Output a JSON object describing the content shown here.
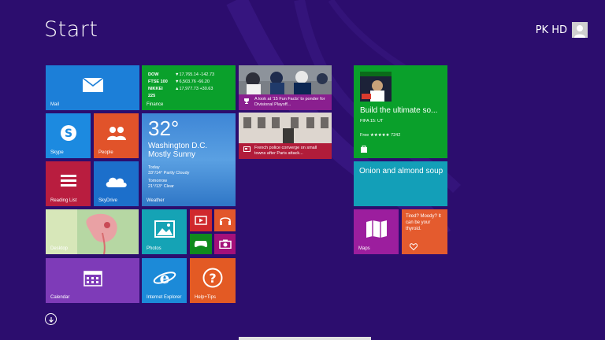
{
  "screen": {
    "title": "Start"
  },
  "user": {
    "name": "PK HD"
  },
  "tiles": {
    "mail": {
      "label": "Mail",
      "color": "#1c7fd8"
    },
    "finance": {
      "label": "Finance",
      "color": "#0aa02b",
      "rows": [
        {
          "name": "DOW",
          "value": "▼17,765.14 -142.73"
        },
        {
          "name": "FTSE 100",
          "value": "▼6,503.76 -66.20"
        },
        {
          "name": "NIKKEI 225",
          "value": "▲17,977.73 +30.63"
        }
      ]
    },
    "news1": {
      "caption": "A look at '15 Fun Facts' to ponder for Divisional Playoff..."
    },
    "news2": {
      "caption": "French police converge on small towns after Paris attack..."
    },
    "xbox": {
      "title": "Build the ultimate so...",
      "subtitle": "FIFA 15: UT",
      "price": "Free ★★★★★ 7242",
      "color": "#0aa02b"
    },
    "skype": {
      "label": "Skype",
      "color": "#1c8ae0"
    },
    "people": {
      "label": "People",
      "color": "#e1532a"
    },
    "weather": {
      "temp": "32°",
      "location": "Washington D.C.",
      "condition": "Mostly Sunny",
      "today_label": "Today",
      "today": "33°/14° Partly Cloudy",
      "tomorrow_label": "Tomorrow",
      "tomorrow": "21°/13° Clear",
      "label": "Weather"
    },
    "food": {
      "title": "Onion and almond soup",
      "color": "#139fb8"
    },
    "readinglist": {
      "label": "Reading List",
      "color": "#b91d3f"
    },
    "skydrive": {
      "label": "SkyDrive",
      "color": "#1c6fcb"
    },
    "desktop": {
      "label": "Desktop"
    },
    "photos": {
      "label": "Photos",
      "color": "#15a3b5"
    },
    "video": {
      "color": "#d0282d"
    },
    "music": {
      "color": "#e2562b"
    },
    "games": {
      "color": "#0f8a1d"
    },
    "camera": {
      "color": "#a4107a"
    },
    "maps": {
      "label": "Maps",
      "color": "#9c1e9e"
    },
    "health": {
      "title": "Tired? Moody? It can be your thyroid.",
      "color": "#e45b2e"
    },
    "calendar": {
      "label": "Calendar",
      "color": "#7e3bb8"
    },
    "ie": {
      "label": "Internet Explorer",
      "color": "#1c8ad8"
    },
    "help": {
      "label": "Help+Tips",
      "color": "#e35a24"
    }
  }
}
